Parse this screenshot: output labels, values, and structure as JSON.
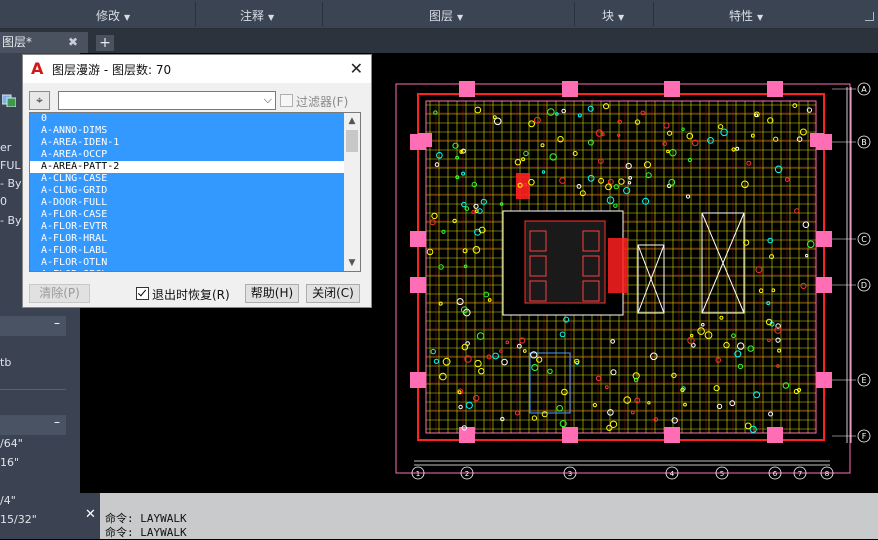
{
  "ribbon": {
    "groups": [
      "修改",
      "注释",
      "图层",
      "块",
      "特性"
    ]
  },
  "tabs": {
    "active": "图层*",
    "add": "+"
  },
  "left_panel": {
    "lines": [
      "er",
      "FUL",
      "- By",
      "0",
      "- By"
    ],
    "lines2": [
      "tb"
    ],
    "lines3": [
      "/64\"",
      "16\"",
      "/4\"",
      "15/32\""
    ]
  },
  "dialog": {
    "title": "图层漫游 - 图层数: 70",
    "filter_placeholder": "",
    "filter_label": "过滤器(F)",
    "layers": [
      "0",
      "A-ANNO-DIMS",
      "A-AREA-IDEN-1",
      "A-AREA-OCCP",
      "A-AREA-PATT-2",
      "A-CLNG-CASE",
      "A-CLNG-GRID",
      "A-DOOR-FULL",
      "A-FLOR-CASE",
      "A-FLOR-EVTR",
      "A-FLOR-HRAL",
      "A-FLOR-LABL",
      "A-FLOR-OTLN",
      "A-FLOR-SPCL"
    ],
    "selected_layer": "A-AREA-PATT-2",
    "buttons": {
      "purge": "清除(P)",
      "restore_on_exit": "退出时恢复(R)",
      "help": "帮助(H)",
      "close": "关闭(C)"
    }
  },
  "drawing": {
    "grid_rows": [
      "A",
      "B",
      "C",
      "D",
      "E",
      "F"
    ],
    "grid_cols": [
      "1",
      "2",
      "3",
      "4",
      "5",
      "6",
      "7",
      "8"
    ]
  },
  "command": {
    "line1": "命令:  LAYWALK",
    "line2": "命令:   LAYWALK"
  },
  "colors": {
    "ribbon_bg": "#3b4453",
    "selection": "#3399ff",
    "column": "#ff6eb4",
    "grid_yellow": "#ffff00",
    "wall_red": "#ff2020"
  }
}
